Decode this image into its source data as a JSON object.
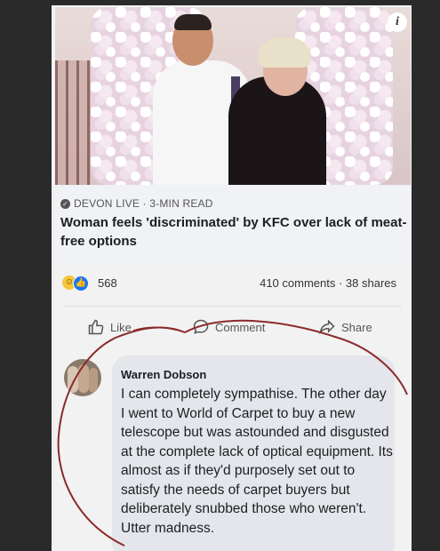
{
  "post": {
    "info_badge": "i",
    "source_line": "DEVON LIVE · 3-MIN READ",
    "headline": "Woman feels 'discriminated' by KFC over lack of meat-free options",
    "reaction_count": "568",
    "engagement": "410 comments · 38 shares"
  },
  "actions": {
    "like_label": "Like",
    "comment_label": "Comment",
    "share_label": "Share"
  },
  "comment": {
    "author": "Warren Dobson",
    "text": "I can completely sympathise. The other day I went to World of Carpet to buy a new telescope but was astounded and disgusted at the complete lack of optical equipment. Its almost as if they'd purposely set out to satisfy the needs of carpet buyers but deliberately snubbed those who weren't. Utter madness."
  },
  "icons": {
    "haha": "haha-reaction-icon",
    "like": "like-reaction-icon",
    "source": "globe-icon"
  },
  "colors": {
    "like_blue": "#1877f2",
    "bubble": "#e4e6eb",
    "annotation_red": "#8b2a2a"
  }
}
